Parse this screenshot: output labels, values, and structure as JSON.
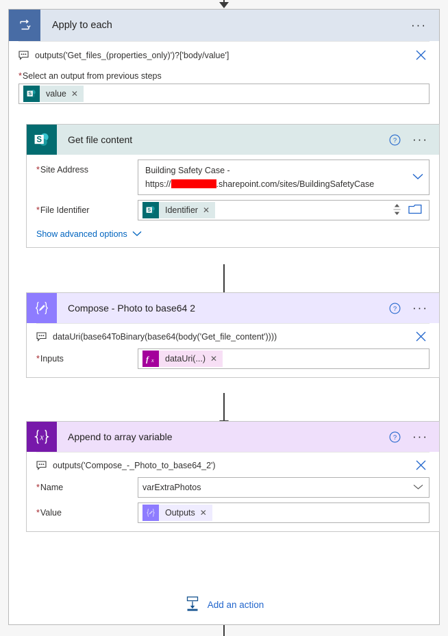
{
  "scope": {
    "title": "Apply to each",
    "icon": "loop-icon",
    "menu_label": "···",
    "expression": "outputs('Get_files_(properties_only)')?['body/value']",
    "expression_icon": "comment-bubble-icon",
    "clear_icon": "close-icon",
    "field_label": "Select an output from previous steps",
    "required_marker": "*",
    "token": {
      "text": "value",
      "icon": "sharepoint-icon",
      "remove": "✕"
    }
  },
  "cards": [
    {
      "title": "Get file content",
      "icon": "sharepoint-icon",
      "help_icon": "question-circle-icon",
      "menu_label": "···",
      "header_bg": "#dce9e9",
      "icon_bg": "#036c70",
      "fields": [
        {
          "label": "Site Address",
          "required": true,
          "type": "dropdown-twoline",
          "line1": "Building Safety Case -",
          "line2_prefix": "https://",
          "line2_redacted": true,
          "line2_suffix": ".sharepoint.com/sites/BuildingSafetyCase",
          "chevron_icon": "chevron-down-icon"
        },
        {
          "label": "File Identifier",
          "required": true,
          "type": "token",
          "token": {
            "text": "Identifier",
            "icon": "sharepoint-icon",
            "remove": "✕"
          },
          "spinner_icon": "stepper-up-down-icon",
          "picker_icon": "folder-picker-icon"
        }
      ],
      "advanced_options": {
        "label": "Show advanced options",
        "chevron_icon": "chevron-down-icon"
      }
    },
    {
      "title": "Compose - Photo to base64 2",
      "icon": "compose-icon",
      "help_icon": "question-circle-icon",
      "menu_label": "···",
      "header_bg": "#ece7ff",
      "icon_bg": "#8e7cff",
      "expression": "dataUri(base64ToBinary(base64(body('Get_file_content'))))",
      "expression_icon": "comment-bubble-icon",
      "clear_icon": "close-icon",
      "fields": [
        {
          "label": "Inputs",
          "required": true,
          "type": "token",
          "token": {
            "text": "dataUri(...)",
            "icon": "function-fx-icon",
            "remove": "✕"
          }
        }
      ]
    },
    {
      "title": "Append to array variable",
      "icon": "variables-icon",
      "help_icon": "question-circle-icon",
      "menu_label": "···",
      "header_bg": "#efdffb",
      "icon_bg": "#7719aa",
      "expression": "outputs('Compose_-_Photo_to_base64_2')",
      "expression_icon": "comment-bubble-icon",
      "clear_icon": "close-icon",
      "fields": [
        {
          "label": "Name",
          "required": true,
          "type": "dropdown",
          "value": "varExtraPhotos",
          "chevron_icon": "chevron-down-icon"
        },
        {
          "label": "Value",
          "required": true,
          "type": "token",
          "token": {
            "text": "Outputs",
            "icon": "compose-outputs-icon",
            "remove": "✕"
          }
        }
      ]
    }
  ],
  "add_action": {
    "label": "Add an action",
    "icon": "insert-action-icon"
  },
  "colors": {
    "scope_header": "#dee5ef",
    "scope_icon": "#486ca5",
    "sharepoint": "#036c70",
    "compose": "#8e7cff",
    "variables": "#7719aa",
    "function": "#a4009b",
    "link": "#0064bf",
    "required": "#a4262c",
    "connector": "#3b3b3b",
    "redaction": "#fe0000"
  }
}
